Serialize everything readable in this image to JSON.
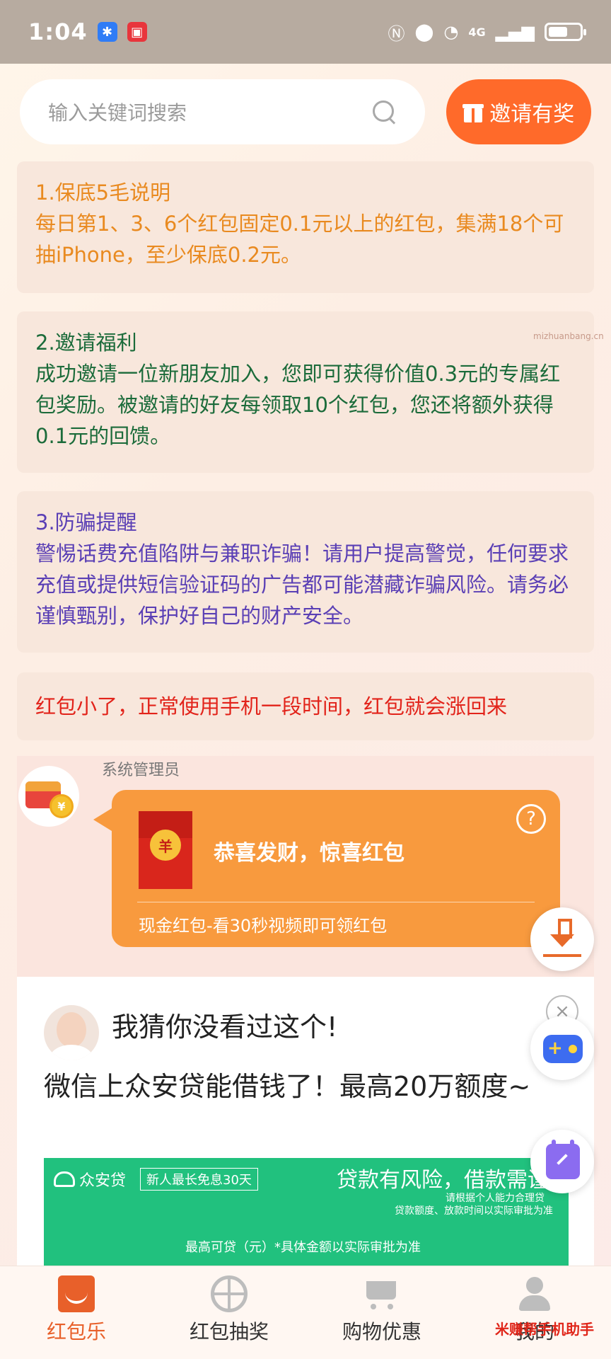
{
  "status_bar": {
    "time": "1:04",
    "network": "4G",
    "icons": [
      "alipay-icon",
      "huawei-store-icon",
      "nfc-icon",
      "location-icon",
      "wifi-icon",
      "signal-icon",
      "battery-icon"
    ]
  },
  "search": {
    "placeholder": "输入关键词搜索",
    "invite_label": "邀请有奖"
  },
  "cards": [
    {
      "title": "1.保底5毛说明",
      "body": "每日第1、3、6个红包固定0.1元以上的红包，集满18个可抽iPhone，至少保底0.2元。",
      "color": "#e98a20"
    },
    {
      "title": "2.邀请福利",
      "body": "成功邀请一位新朋友加入，您即可获得价值0.3元的专属红包奖励。被邀请的好友每领取10个红包，您还将额外获得0.1元的回馈。",
      "color": "#1b6b3a"
    },
    {
      "title": "3.防骗提醒",
      "body": "警惕话费充值陷阱与兼职诈骗！请用户提高警觉，任何要求充值或提供短信验证码的广告都可能潜藏诈骗风险。请务必谨慎甄别，保护好自己的财产安全。",
      "color": "#5a3fb5"
    },
    {
      "body": "红包小了，正常使用手机一段时间，红包就会涨回来",
      "color": "#e2231a"
    }
  ],
  "chat": {
    "sender": "系统管理员",
    "bubble_title": "恭喜发财，惊喜红包",
    "bubble_sub": "现金红包-看30秒视频即可领红包",
    "help": "?",
    "coin_symbol": "¥",
    "rp_symbol": "羊",
    "bubble_color": "#f89a3e"
  },
  "ad": {
    "headline": "我猜你没看过这个!",
    "title": "微信上众安贷能借钱了！最高20万额度~",
    "close": "×",
    "banner": {
      "logo": "众安贷",
      "tag": "新人最长免息30天",
      "risk": "贷款有风险，借款需谨",
      "small1": "请根据个人能力合理贷",
      "small2": "贷款额度、放款时间以实际审批为准",
      "max": "最高可贷（元）*具体金额以实际审批为准"
    }
  },
  "bottom_nav": {
    "items": [
      {
        "label": "红包乐",
        "icon": "red-packet-icon",
        "active": true
      },
      {
        "label": "红包抽奖",
        "icon": "lottery-wheel-icon",
        "active": false
      },
      {
        "label": "购物优惠",
        "icon": "shopping-cart-icon",
        "active": false
      },
      {
        "label": "我的",
        "icon": "user-icon",
        "active": false
      }
    ]
  },
  "watermark": "米赚帮手机助手",
  "watermark_url": "mizhuanbang.cn",
  "colors": {
    "accent": "#ff6a2a",
    "active_tab": "#e8602a",
    "ad_green": "#21c17e"
  }
}
